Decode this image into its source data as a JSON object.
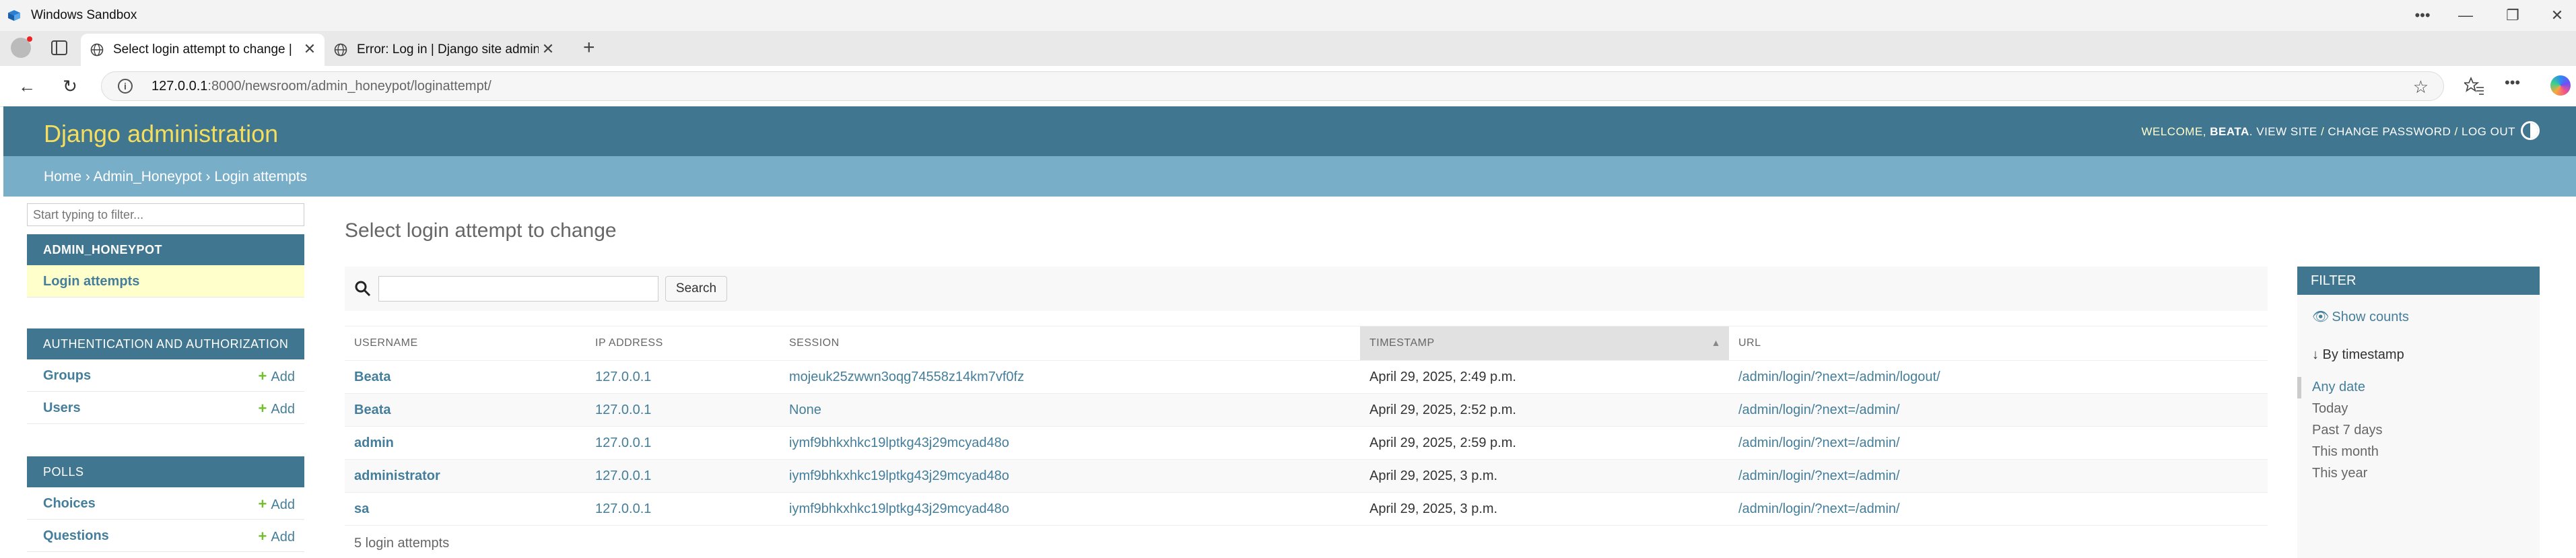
{
  "window": {
    "title": "Windows Sandbox"
  },
  "tabs": [
    {
      "title": "Select login attempt to change | D",
      "active": true
    },
    {
      "title": "Error: Log in | Django site admin",
      "active": false
    }
  ],
  "address": {
    "host": "127.0.0.1",
    "rest": ":8000/newsroom/admin_honeypot/loginattempt/"
  },
  "header": {
    "brand": "Django administration",
    "welcome": "WELCOME,",
    "user": "BEATA",
    "view_site": "VIEW SITE",
    "change_password": "CHANGE PASSWORD",
    "log_out": "LOG OUT"
  },
  "breadcrumbs": {
    "home": "Home",
    "app": "Admin_Honeypot",
    "current": "Login attempts",
    "sep": "›"
  },
  "sidebar": {
    "filter_placeholder": "Start typing to filter...",
    "apps": [
      {
        "caption": "ADMIN_HONEYPOT",
        "models": [
          {
            "name": "Login attempts",
            "add": ""
          }
        ]
      },
      {
        "caption": "AUTHENTICATION AND AUTHORIZATION",
        "models": [
          {
            "name": "Groups",
            "add": "Add"
          },
          {
            "name": "Users",
            "add": "Add"
          }
        ]
      },
      {
        "caption": "POLLS",
        "models": [
          {
            "name": "Choices",
            "add": "Add"
          },
          {
            "name": "Questions",
            "add": "Add"
          }
        ]
      }
    ]
  },
  "content": {
    "title": "Select login attempt to change",
    "search_button": "Search",
    "columns": [
      "USERNAME",
      "IP ADDRESS",
      "SESSION",
      "TIMESTAMP",
      "URL"
    ],
    "rows": [
      {
        "username": "Beata",
        "ip": "127.0.0.1",
        "session": "mojeuk25zwwn3oqg74558z14km7vf0fz",
        "timestamp": "April 29, 2025, 2:49 p.m.",
        "url": "/admin/login/?next=/admin/logout/"
      },
      {
        "username": "Beata",
        "ip": "127.0.0.1",
        "session": "None",
        "timestamp": "April 29, 2025, 2:52 p.m.",
        "url": "/admin/login/?next=/admin/"
      },
      {
        "username": "admin",
        "ip": "127.0.0.1",
        "session": "iymf9bhkxhkc19lptkg43j29mcyad48o",
        "timestamp": "April 29, 2025, 2:59 p.m.",
        "url": "/admin/login/?next=/admin/"
      },
      {
        "username": "administrator",
        "ip": "127.0.0.1",
        "session": "iymf9bhkxhkc19lptkg43j29mcyad48o",
        "timestamp": "April 29, 2025, 3 p.m.",
        "url": "/admin/login/?next=/admin/"
      },
      {
        "username": "sa",
        "ip": "127.0.0.1",
        "session": "iymf9bhkxhkc19lptkg43j29mcyad48o",
        "timestamp": "April 29, 2025, 3 p.m.",
        "url": "/admin/login/?next=/admin/"
      }
    ],
    "paginator": "5 login attempts"
  },
  "filter": {
    "title": "FILTER",
    "show_counts": "Show counts",
    "by_timestamp": "↓ By timestamp",
    "options": [
      "Any date",
      "Today",
      "Past 7 days",
      "This month",
      "This year"
    ],
    "selected": "Any date"
  },
  "colors": {
    "header": "#417690",
    "breadcrumbs": "#79aec8",
    "brand": "#f5dd5d",
    "link": "#447e9b",
    "current_row": "#ffffcc",
    "add_plus": "#70bf2b"
  }
}
